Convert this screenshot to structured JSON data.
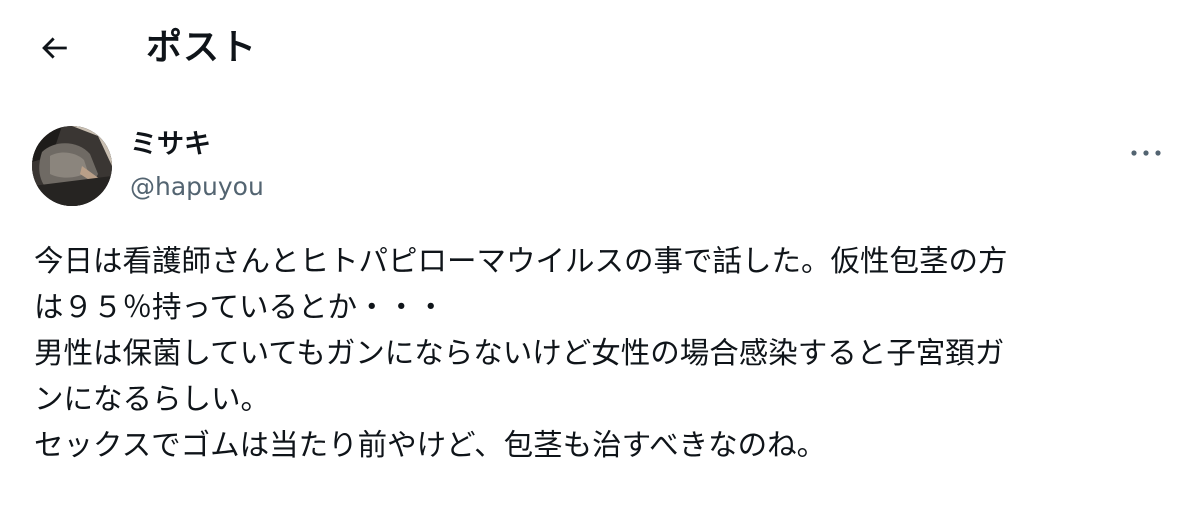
{
  "header": {
    "back_icon": "arrow-left-icon",
    "title": "ポスト"
  },
  "post": {
    "author": {
      "display_name": "ミサキ",
      "handle": "@hapuyou"
    },
    "more_icon": "more-horizontal-icon",
    "text_lines": [
      "今日は看護師さんとヒトパピローマウイルスの事で話した。仮性包茎の方",
      "は９５％持っているとか・・・",
      "男性は保菌していてもガンにならないけど女性の場合感染すると子宮頚ガ",
      "ンになるらしい。",
      "セックスでゴムは当たり前やけど、包茎も治すべきなのね。"
    ]
  },
  "colors": {
    "text_primary": "#0f1419",
    "text_secondary": "#536471",
    "background": "#ffffff"
  }
}
